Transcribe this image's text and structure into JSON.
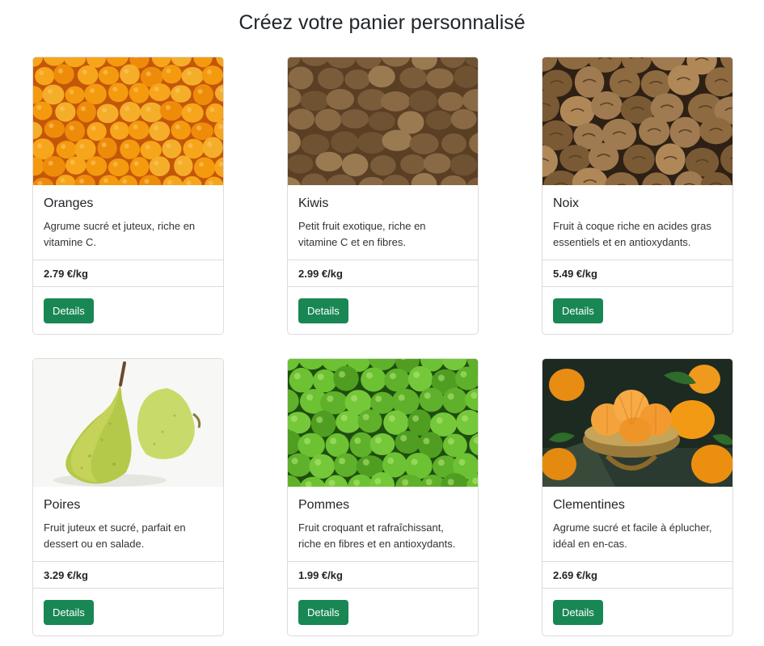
{
  "page": {
    "title": "Créez votre panier personnalisé"
  },
  "products": [
    {
      "name": "Oranges",
      "description": "Agrume sucré et juteux, riche en vitamine C.",
      "price": "2.79 €/kg",
      "button": "Details",
      "image_icon": "oranges-photo"
    },
    {
      "name": "Kiwis",
      "description": "Petit fruit exotique, riche en vitamine C et en fibres.",
      "price": "2.99 €/kg",
      "button": "Details",
      "image_icon": "kiwis-photo"
    },
    {
      "name": "Noix",
      "description": "Fruit à coque riche en acides gras essentiels et en antioxydants.",
      "price": "5.49 €/kg",
      "button": "Details",
      "image_icon": "walnuts-photo"
    },
    {
      "name": "Poires",
      "description": "Fruit juteux et sucré, parfait en dessert ou en salade.",
      "price": "3.29 €/kg",
      "button": "Details",
      "image_icon": "pears-photo"
    },
    {
      "name": "Pommes",
      "description": "Fruit croquant et rafraîchissant, riche en fibres et en antioxydants.",
      "price": "1.99 €/kg",
      "button": "Details",
      "image_icon": "apples-photo"
    },
    {
      "name": "Clementines",
      "description": "Agrume sucré et facile à éplucher, idéal en en-cas.",
      "price": "2.69 €/kg",
      "button": "Details",
      "image_icon": "clementines-photo"
    }
  ],
  "colors": {
    "button": "#198754",
    "border": "#dcdcdc",
    "text": "#212529"
  }
}
